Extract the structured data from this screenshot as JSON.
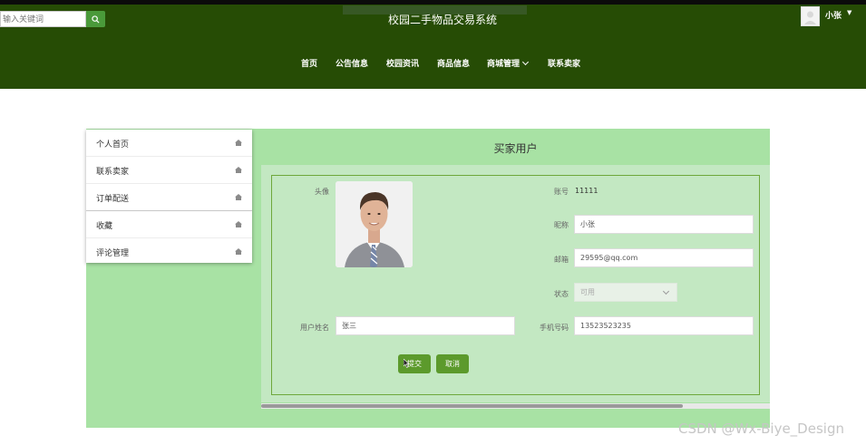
{
  "search": {
    "placeholder": "输入关键词"
  },
  "header": {
    "title": "校园二手物品交易系统",
    "username": "小张",
    "caret": "▼"
  },
  "nav": {
    "items": [
      "首页",
      "公告信息",
      "校园资讯",
      "商品信息",
      "商城管理",
      "联系卖家"
    ]
  },
  "sidebar": {
    "items": [
      "个人首页",
      "联系卖家",
      "订单配送",
      "收藏",
      "评论管理"
    ]
  },
  "page": {
    "title": "买家用户"
  },
  "form": {
    "avatar_label": "头像",
    "account_label": "账号",
    "account_value": "11111",
    "nickname_label": "昵称",
    "nickname_value": "小张",
    "email_label": "邮箱",
    "email_value": "29595@qq.com",
    "status_label": "状态",
    "status_value": "可用",
    "realname_label": "用户姓名",
    "realname_value": "张三",
    "phone_label": "手机号码",
    "phone_value": "13523523235",
    "submit_label": "提交",
    "cancel_label": "取消"
  },
  "watermark": "CSDN @Wx-Biye_Design",
  "colors": {
    "header_bg": "#264c05",
    "content_bg": "#a8e2a4",
    "panel_bg": "#c3e8c2",
    "button_bg": "#5c9a2c"
  }
}
